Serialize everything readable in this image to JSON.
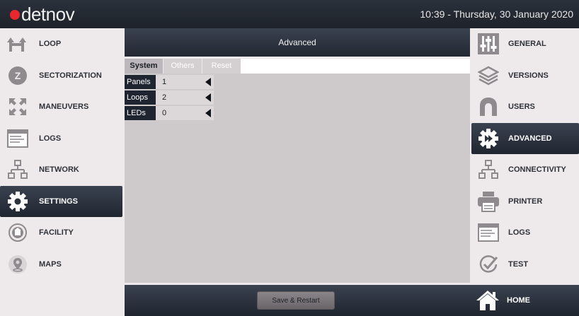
{
  "header": {
    "logo_text": "detnov",
    "datetime": "10:39  -  Thursday, 30 January 2020",
    "brand_color": "#e8272e"
  },
  "left_nav": {
    "items": [
      {
        "label": "LOOP",
        "icon": "loop-icon"
      },
      {
        "label": "SECTORIZATION",
        "icon": "sectorization-icon"
      },
      {
        "label": "MANEUVERS",
        "icon": "maneuvers-icon"
      },
      {
        "label": "LOGS",
        "icon": "logs-icon"
      },
      {
        "label": "NETWORK",
        "icon": "network-icon"
      },
      {
        "label": "SETTINGS",
        "icon": "gear-icon",
        "active": true
      },
      {
        "label": "FACILITY",
        "icon": "facility-icon"
      },
      {
        "label": "MAPS",
        "icon": "map-pin-icon"
      }
    ]
  },
  "right_nav": {
    "items": [
      {
        "label": "GENERAL",
        "icon": "sliders-icon"
      },
      {
        "label": "VERSIONS",
        "icon": "layers-icon"
      },
      {
        "label": "USERS",
        "icon": "user-icon"
      },
      {
        "label": "ADVANCED",
        "icon": "advanced-gear-icon",
        "active": true
      },
      {
        "label": "CONNECTIVITY",
        "icon": "network-icon"
      },
      {
        "label": "PRINTER",
        "icon": "printer-icon"
      },
      {
        "label": "LOGS",
        "icon": "logs-icon"
      },
      {
        "label": "TEST",
        "icon": "check-icon"
      }
    ],
    "home_label": "HOME"
  },
  "main": {
    "title": "Advanced",
    "tabs": [
      {
        "label": "System",
        "active": true
      },
      {
        "label": "Others"
      },
      {
        "label": "Reset"
      }
    ],
    "rows": [
      {
        "label": "Panels",
        "value": "1"
      },
      {
        "label": "Loops",
        "value": "2"
      },
      {
        "label": "LEDs",
        "value": "0"
      }
    ],
    "save_label": "Save & Restart"
  }
}
